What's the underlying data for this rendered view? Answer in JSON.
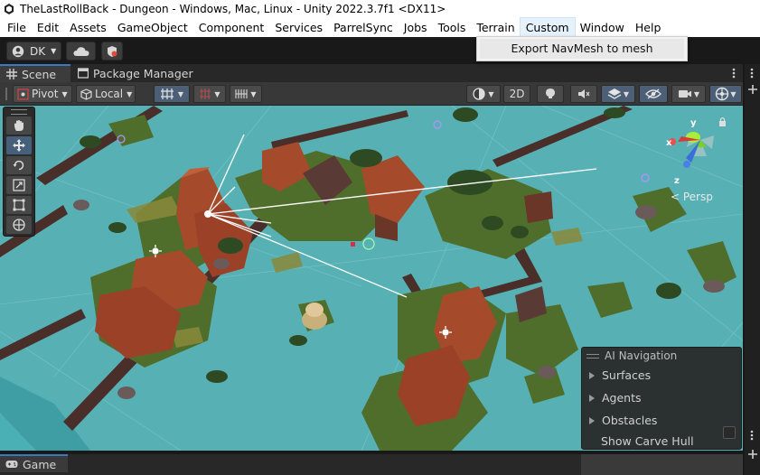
{
  "window": {
    "title": "TheLastRollBack - Dungeon - Windows, Mac, Linux - Unity 2022.3.7f1 <DX11>"
  },
  "menu": {
    "items": [
      "File",
      "Edit",
      "Assets",
      "GameObject",
      "Component",
      "Services",
      "ParrelSync",
      "Jobs",
      "Tools",
      "Terrain",
      "Custom",
      "Window",
      "Help"
    ],
    "active": "Custom",
    "dropdown": {
      "items": [
        "Export NavMesh to mesh"
      ]
    }
  },
  "toolbar": {
    "account_label": "DK",
    "account_icon": "user-circle-icon",
    "cloud_icon": "cloud-icon",
    "collab_icon": "collab-icon"
  },
  "tabs": {
    "scene_label": "Scene",
    "package_manager_label": "Package Manager",
    "game_label": "Game"
  },
  "scene_toolbar": {
    "pivot_label": "Pivot",
    "local_label": "Local",
    "mode_2d_label": "2D"
  },
  "gizmo": {
    "persp_label": "< Persp",
    "y_label": "y",
    "x_label": "x",
    "z_label": "z"
  },
  "ai_navigation": {
    "title": "AI Navigation",
    "sections": [
      "Surfaces",
      "Agents",
      "Obstacles"
    ],
    "option_label": "Show Carve Hull",
    "option_checked": false
  },
  "colors": {
    "accent": "#3a79bb",
    "water": "#57b1b4",
    "grass": "#4f6e2c",
    "roof": "#a64a2c"
  }
}
